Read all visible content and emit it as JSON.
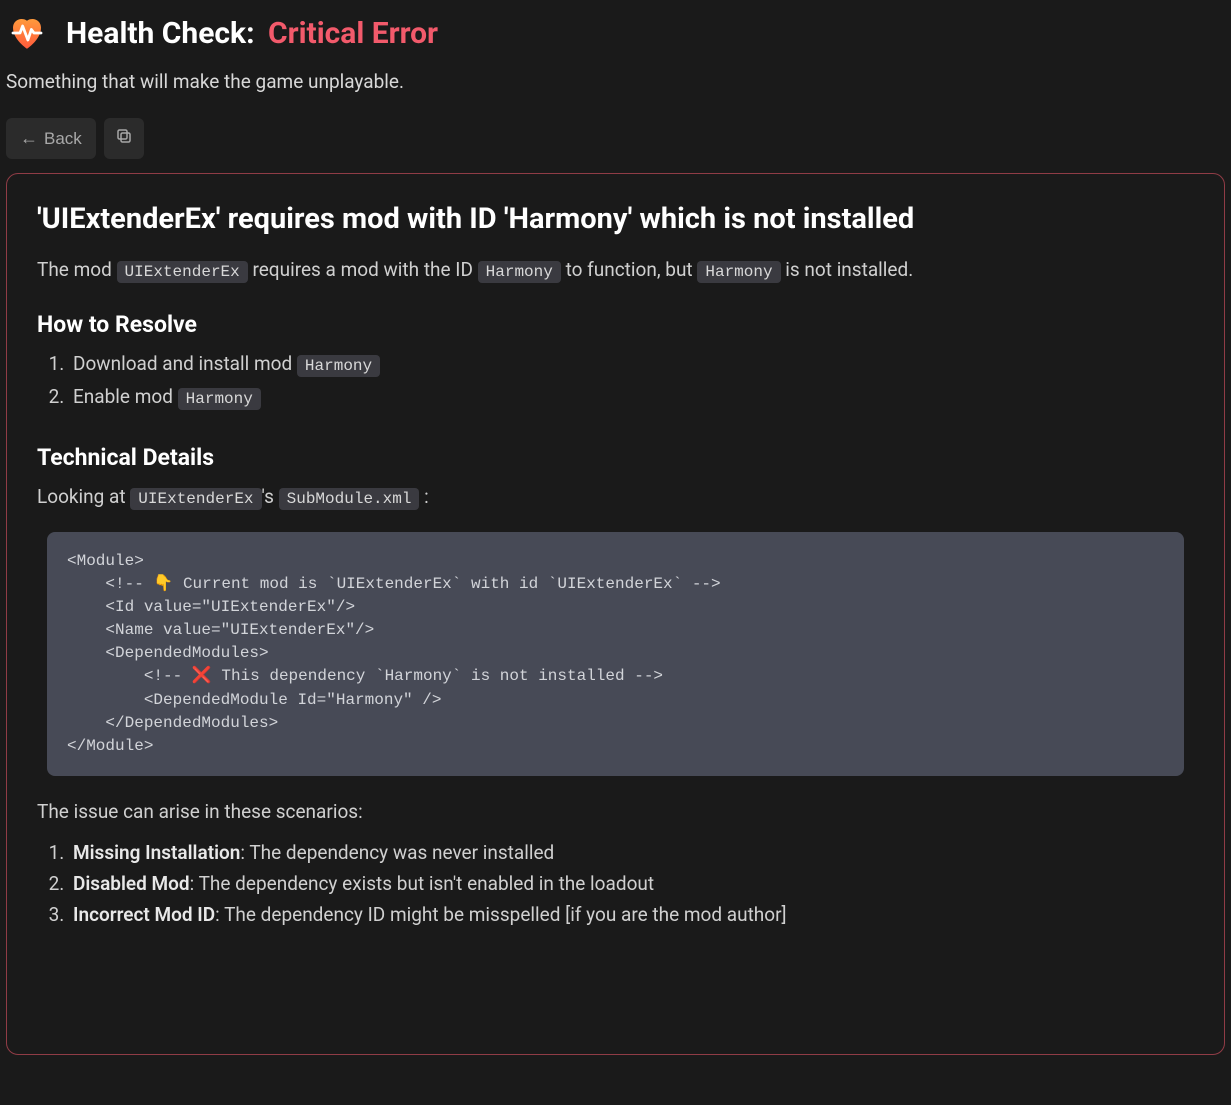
{
  "header": {
    "title_prefix": "Health Check:",
    "error_label": "Critical Error",
    "subtitle": "Something that will make the game unplayable."
  },
  "toolbar": {
    "back_label": "Back"
  },
  "card": {
    "title": "'UIExtenderEx' requires mod with ID 'Harmony' which is not installed",
    "description": {
      "p1": "The mod ",
      "c1": "UIExtenderEx",
      "p2": " requires a mod with the ID ",
      "c2": "Harmony",
      "p3": " to function, but ",
      "c3": "Harmony",
      "p4": " is not installed."
    },
    "resolve_heading": "How to Resolve",
    "resolve": {
      "item1_text": "Download and install mod ",
      "item1_code": "Harmony",
      "item2_text": "Enable mod ",
      "item2_code": "Harmony"
    },
    "tech_heading": "Technical Details",
    "tech_para": {
      "p1": "Looking at ",
      "c1": "UIExtenderEx",
      "p2": "'s ",
      "c2": "SubModule.xml",
      "p3": " :"
    },
    "code": "<Module>\n    <!-- 👇 Current mod is `UIExtenderEx` with id `UIExtenderEx` -->\n    <Id value=\"UIExtenderEx\"/>\n    <Name value=\"UIExtenderEx\"/>\n    <DependedModules>\n        <!-- ❌ This dependency `Harmony` is not installed -->\n        <DependedModule Id=\"Harmony\" />\n    </DependedModules>\n</Module>",
    "scenarios_intro": "The issue can arise in these scenarios:",
    "scenarios": {
      "s1_bold": "Missing Installation",
      "s1_text": ": The dependency was never installed",
      "s2_bold": "Disabled Mod",
      "s2_text": ": The dependency exists but isn't enabled in the loadout",
      "s3_bold": "Incorrect Mod ID",
      "s3_text": ": The dependency ID might be misspelled [if you are the mod author]"
    }
  }
}
